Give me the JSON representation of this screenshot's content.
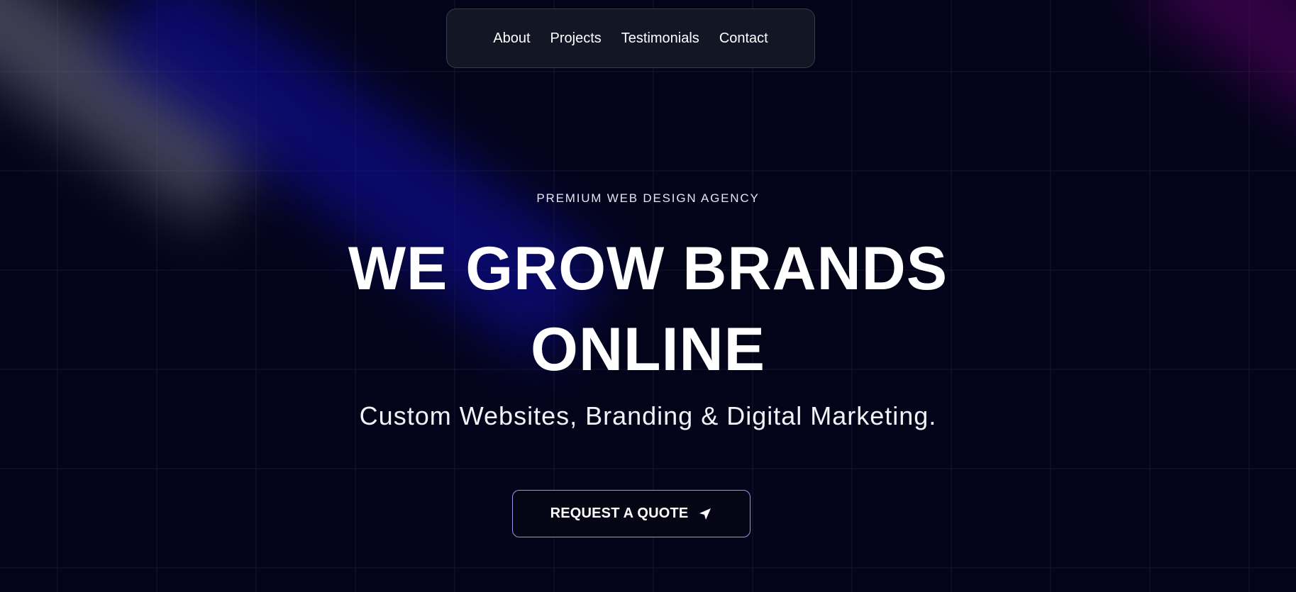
{
  "nav": {
    "items": [
      {
        "label": "About"
      },
      {
        "label": "Projects"
      },
      {
        "label": "Testimonials"
      },
      {
        "label": "Contact"
      }
    ]
  },
  "hero": {
    "eyebrow": "PREMIUM WEB DESIGN AGENCY",
    "headline_line1": "WE GROW BRANDS",
    "headline_line2": "ONLINE",
    "subtitle": "Custom Websites, Branding & Digital Marketing.",
    "cta_label": "REQUEST A QUOTE",
    "cta_icon": "send-arrow-icon"
  },
  "theme": {
    "background": "#03031a",
    "nav_background": "#161a28",
    "cta_border": "#9c8ff0",
    "glow_blue": "#0f0faa",
    "glow_purple": "#6e0078"
  }
}
